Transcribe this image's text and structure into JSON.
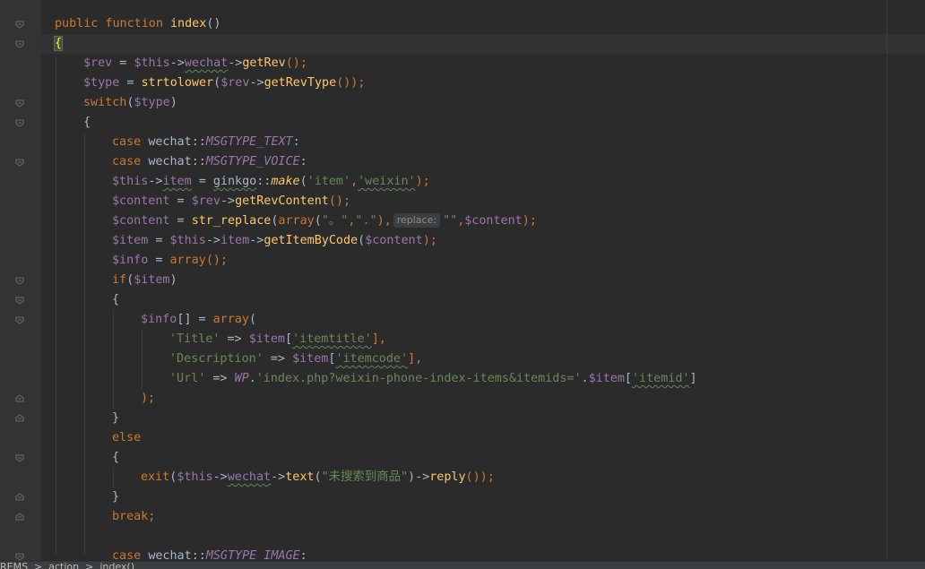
{
  "editor": {
    "language": "PHP",
    "theme_colors": {
      "background": "#2b2b2b",
      "gutter": "#313335",
      "keyword": "#cc7832",
      "variable": "#9876aa",
      "function": "#ffc66d",
      "string": "#6a8759",
      "plain": "#a9b7c6"
    },
    "param_hint": "replace:",
    "breadcrumb": "REMS  >  action  >  index()"
  },
  "code": {
    "l1_kw": "public function ",
    "l1_fn": "index",
    "l1_rest": "()",
    "l2_brace": "{",
    "l3_a": "$rev",
    "l3_b": " = ",
    "l3_c": "$this",
    "l3_d": "->",
    "l3_e": "wechat",
    "l3_f": "->",
    "l3_g": "getRev",
    "l3_h": "();",
    "l4_a": "$type",
    "l4_b": " = ",
    "l4_c": "strtolower",
    "l4_d": "(",
    "l4_e": "$rev",
    "l4_f": "->",
    "l4_g": "getRevType",
    "l4_h": "());",
    "l5_kw": "switch",
    "l5_b": "(",
    "l5_c": "$type",
    "l5_d": ")",
    "l6": "{",
    "l7_kw": "case ",
    "l7_b": "wechat",
    "l7_c": "::",
    "l7_d": "MSGTYPE_TEXT",
    "l7_e": ":",
    "l8_kw": "case ",
    "l8_b": "wechat",
    "l8_c": "::",
    "l8_d": "MSGTYPE_VOICE",
    "l8_e": ":",
    "l9_a": "$this",
    "l9_b": "->",
    "l9_c": "item",
    "l9_d": " = ",
    "l9_e": "ginkgo",
    "l9_f": "::",
    "l9_g": "make",
    "l9_h": "(",
    "l9_i": "'item'",
    "l9_j": ",",
    "l9_k": "'weixin'",
    "l9_l": ");",
    "l10_a": "$content",
    "l10_b": " = ",
    "l10_c": "$rev",
    "l10_d": "->",
    "l10_e": "getRevContent",
    "l10_f": "();",
    "l11_a": "$content",
    "l11_b": " = ",
    "l11_c": "str_replace",
    "l11_d": "(",
    "l11_e": "array",
    "l11_f": "(",
    "l11_g": "\"。\"",
    "l11_h": ",",
    "l11_i": "\".\"",
    "l11_j": "),",
    "l11_k": "\"\"",
    "l11_l": ",",
    "l11_m": "$content",
    "l11_n": ");",
    "l12_a": "$item",
    "l12_b": " = ",
    "l12_c": "$this",
    "l12_d": "->",
    "l12_e": "item",
    "l12_f": "->",
    "l12_g": "getItemByCode",
    "l12_h": "(",
    "l12_i": "$content",
    "l12_j": ");",
    "l13_a": "$info",
    "l13_b": " = ",
    "l13_c": "array",
    "l13_d": "();",
    "l14_kw": "if",
    "l14_b": "(",
    "l14_c": "$item",
    "l14_d": ")",
    "l15": "{",
    "l16_a": "$info",
    "l16_b": "[] = ",
    "l16_c": "array",
    "l16_d": "(",
    "l17_a": "'Title'",
    "l17_b": " => ",
    "l17_c": "$item",
    "l17_d": "[",
    "l17_e": "'itemtitle'",
    "l17_f": "],",
    "l18_a": "'Description'",
    "l18_b": " => ",
    "l18_c": "$item",
    "l18_d": "[",
    "l18_e": "'itemcode'",
    "l18_f": "],",
    "l19_a": "'Url'",
    "l19_b": " => ",
    "l19_c": "WP",
    "l19_d": ".",
    "l19_e": "'index.php?weixin-phone-index-items&itemids='",
    "l19_f": ".",
    "l19_g": "$item",
    "l19_h": "[",
    "l19_i": "'itemid'",
    "l19_j": "]",
    "l20": ");",
    "l21": "}",
    "l22_kw": "else",
    "l23": "{",
    "l24_a": "exit",
    "l24_b": "(",
    "l24_c": "$this",
    "l24_d": "->",
    "l24_e": "wechat",
    "l24_f": "->",
    "l24_g": "text",
    "l24_h": "(",
    "l24_i": "\"未搜索到商品\"",
    "l24_j": ")->",
    "l24_k": "reply",
    "l24_l": "());",
    "l25": "}",
    "l26_kw": "break;",
    "l28_kw": "case ",
    "l28_b": "wechat",
    "l28_c": "::",
    "l28_d": "MSGTYPE_IMAGE",
    "l28_e": ":"
  }
}
